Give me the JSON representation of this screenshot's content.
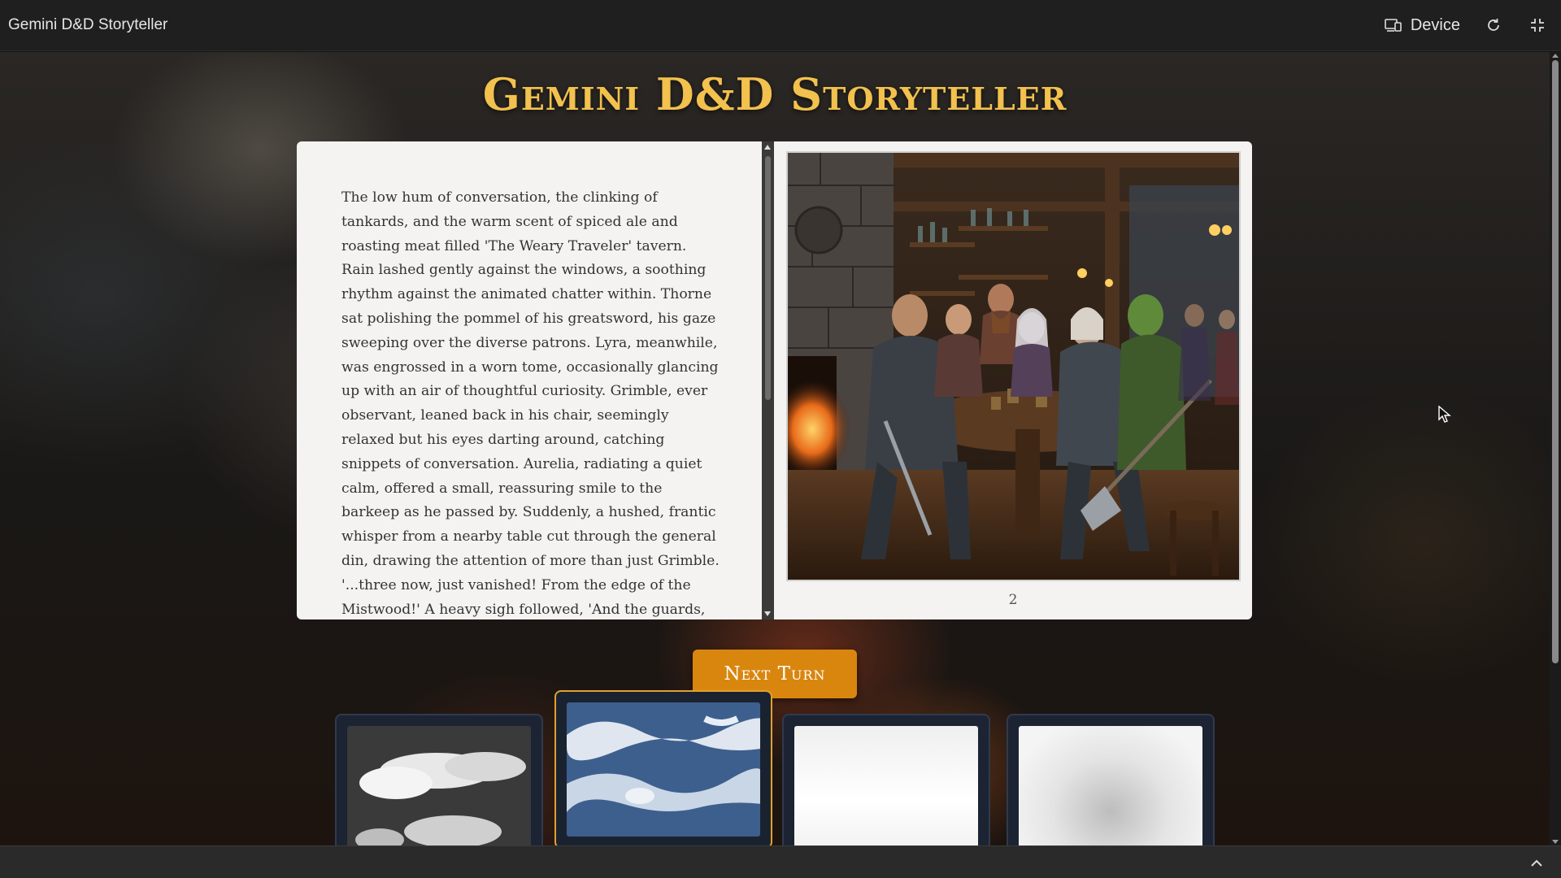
{
  "window": {
    "title": "Gemini D&D Storyteller",
    "device_label": "Device"
  },
  "main": {
    "heading": "Gemini D&D Storyteller",
    "story_text": "The low hum of conversation, the clinking of tankards, and the warm scent of spiced ale and roasting meat filled 'The Weary Traveler' tavern. Rain lashed gently against the windows, a soothing rhythm against the animated chatter within. Thorne sat polishing the pommel of his greatsword, his gaze sweeping over the diverse patrons. Lyra, meanwhile, was engrossed in a worn tome, occasionally glancing up with an air of thoughtful curiosity. Grimble, ever observant, leaned back in his chair, seemingly relaxed but his eyes darting around, catching snippets of conversation. Aurelia, radiating a quiet calm, offered a small, reassuring smile to the barkeep as he passed by. Suddenly, a hushed, frantic whisper from a nearby table cut through the general din, drawing the attention of more than just Grimble. '...three now, just vanished! From the edge of the Mistwood!' A heavy sigh followed, 'And the guards, bless 'em, they've found nothing.' A moment later, a",
    "page_number": "2",
    "next_turn_label": "Next Turn"
  },
  "cards": [
    {
      "name": "card-clouds",
      "selected": false
    },
    {
      "name": "card-blue-waves",
      "selected": true
    },
    {
      "name": "card-white",
      "selected": false
    },
    {
      "name": "card-mist",
      "selected": false
    }
  ],
  "colors": {
    "accent_gold": "#f2c14e",
    "button_orange": "#d9860f",
    "selected_border": "#e0a030",
    "topbar_bg": "#1f1f1f"
  },
  "icons": {
    "device": "device-icon",
    "refresh": "refresh-icon",
    "fullscreen": "collapse-icon",
    "bottom": "chevron-up-icon"
  }
}
